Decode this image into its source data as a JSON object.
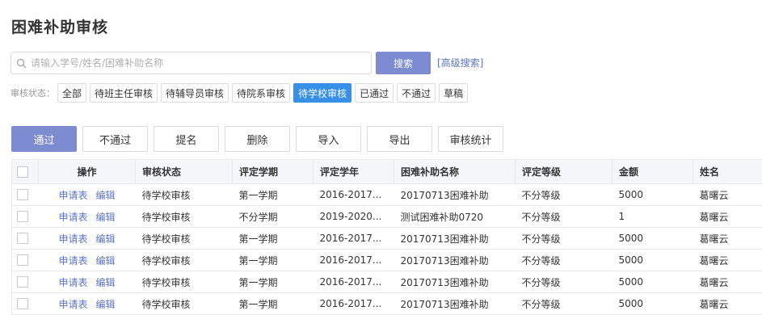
{
  "page": {
    "title": "困难补助审核"
  },
  "search": {
    "placeholder": "请输入学号/姓名/困难补助名称",
    "value": "",
    "button_label": "搜索",
    "advanced_label": "[高级搜索]"
  },
  "filter": {
    "label": "审核状态：",
    "options": [
      "全部",
      "待班主任审核",
      "待辅导员审核",
      "待院系审核",
      "待学校审核",
      "已通过",
      "不通过",
      "草稿"
    ],
    "selected": "待学校审核"
  },
  "toolbar": {
    "buttons": [
      "通过",
      "不通过",
      "提名",
      "删除",
      "导入",
      "导出",
      "审核统计"
    ]
  },
  "table": {
    "columns": [
      "操作",
      "审核状态",
      "评定学期",
      "评定学年",
      "困难补助名称",
      "评定等级",
      "金额",
      "姓名"
    ],
    "row_actions": [
      "申请表",
      "编辑"
    ],
    "rows": [
      [
        "待学校审核",
        "第一学期",
        "2016-2017...",
        "20170713困难补助",
        "不分等级",
        "5000",
        "葛曙云"
      ],
      [
        "待学校审核",
        "不分学期",
        "2019-2020...",
        "测试困难补助0720",
        "不分等级",
        "1",
        "葛曙云"
      ],
      [
        "待学校审核",
        "第一学期",
        "2016-2017...",
        "20170713困难补助",
        "不分等级",
        "5000",
        "葛曙云"
      ],
      [
        "待学校审核",
        "第一学期",
        "2016-2017...",
        "20170713困难补助",
        "不分等级",
        "5000",
        "葛曙云"
      ],
      [
        "待学校审核",
        "第一学期",
        "2016-2017...",
        "20170713困难补助",
        "不分等级",
        "5000",
        "葛曙云"
      ],
      [
        "待学校审核",
        "第一学期",
        "2016-2017...",
        "20170713困难补助",
        "不分等级",
        "5000",
        "葛曙云"
      ]
    ]
  },
  "colors": {
    "primary": "#7d8bd0",
    "active_chip": "#3790e8",
    "link": "#5a74c6"
  }
}
